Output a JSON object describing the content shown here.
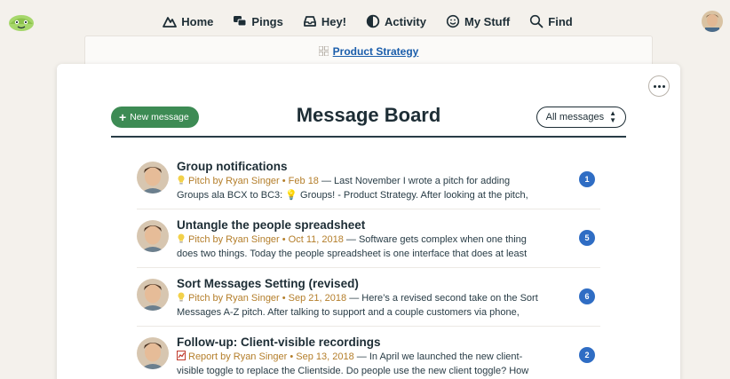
{
  "nav": {
    "items": [
      {
        "label": "Home",
        "icon": "mountain-icon"
      },
      {
        "label": "Pings",
        "icon": "chat-bubbles-icon"
      },
      {
        "label": "Hey!",
        "icon": "inbox-tray-icon"
      },
      {
        "label": "Activity",
        "icon": "half-circle-icon"
      },
      {
        "label": "My Stuff",
        "icon": "smiley-icon"
      },
      {
        "label": "Find",
        "icon": "magnifier-icon"
      }
    ]
  },
  "project": {
    "name": "Product Strategy"
  },
  "board": {
    "new_message_label": "New message",
    "title": "Message Board",
    "filter_label": "All messages"
  },
  "messages": [
    {
      "title": "Group notifications",
      "category": "Pitch",
      "meta": "Pitch by Ryan Singer • Feb 18",
      "excerpt_line1": " — Last November I wrote a pitch for adding",
      "excerpt_line2": "Groups ala BCX to BC3: 💡 Groups! - Product Strategy. After looking at the pitch,",
      "count": "1"
    },
    {
      "title": "Untangle the people spreadsheet",
      "category": "Pitch",
      "meta": "Pitch by Ryan Singer • Oct 11, 2018",
      "excerpt_line1": " — Software gets complex when one thing",
      "excerpt_line2": "does two things. Today the people spreadsheet is one interface that does at least",
      "count": "5"
    },
    {
      "title": "Sort Messages Setting (revised)",
      "category": "Pitch",
      "meta": "Pitch by Ryan Singer • Sep 21, 2018",
      "excerpt_line1": " — Here’s a revised second take on the Sort",
      "excerpt_line2": "Messages A-Z pitch. After talking to support and a couple customers via phone,",
      "count": "6"
    },
    {
      "title": "Follow-up: Client-visible recordings",
      "category": "Report",
      "meta": "Report by Ryan Singer • Sep 13, 2018",
      "excerpt_line1": " — In April we launched the new client-",
      "excerpt_line2": "visible toggle to replace the Clientside. Do people use the new client toggle? How",
      "count": "2"
    }
  ],
  "colors": {
    "background": "#f4f1ec",
    "accent_green": "#3d8b54",
    "link_blue": "#1a5dab",
    "count_blue": "#2f6dc4",
    "meta_brown": "#b47e2a"
  }
}
